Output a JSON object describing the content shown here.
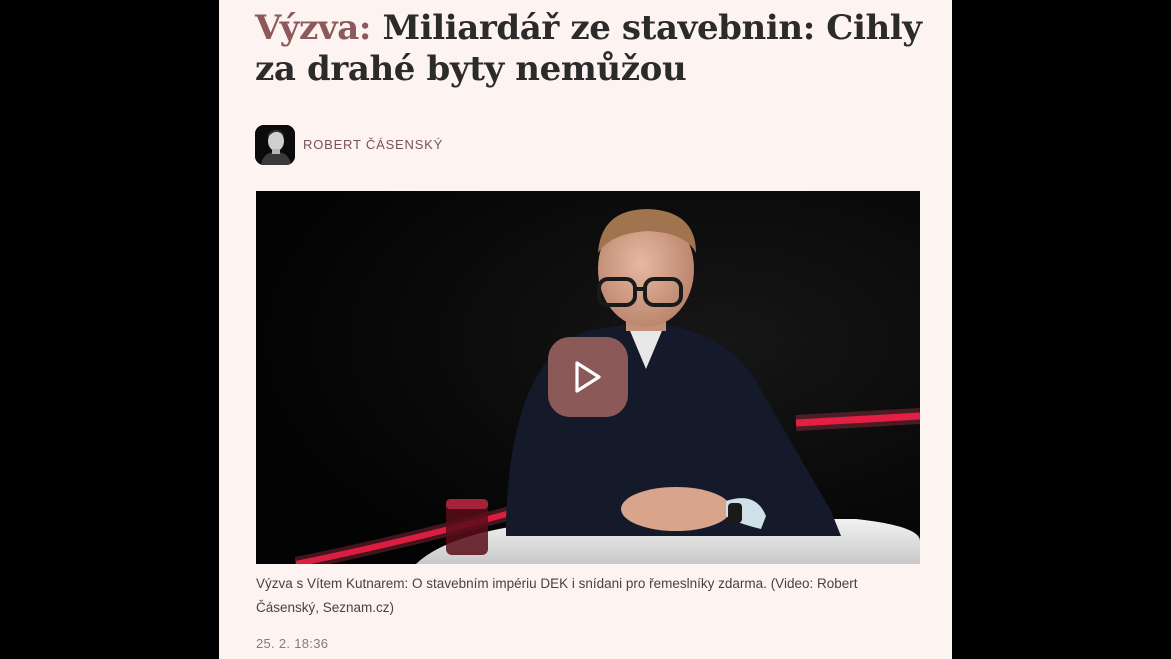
{
  "article": {
    "headline_prefix": "Výzva:",
    "headline_text": " Miliardář ze stavebnin: Cihly za drahé byty nemůžou",
    "author": "ROBERT ČÁSENSKÝ",
    "caption": "Výzva s Vítem Kutnarem: O stavebním impériu DEK i snídani pro řemeslníky zdarma. (Video: Robert Čásenský, Seznam.cz)",
    "timestamp": "25. 2. 18:36"
  },
  "video": {
    "play_icon": "play-icon"
  },
  "colors": {
    "page_background": "#000000",
    "article_background": "#fdf4f2",
    "accent": "#8c5a5a",
    "play_button": "#96605c",
    "studio_light": "#e8103a"
  }
}
